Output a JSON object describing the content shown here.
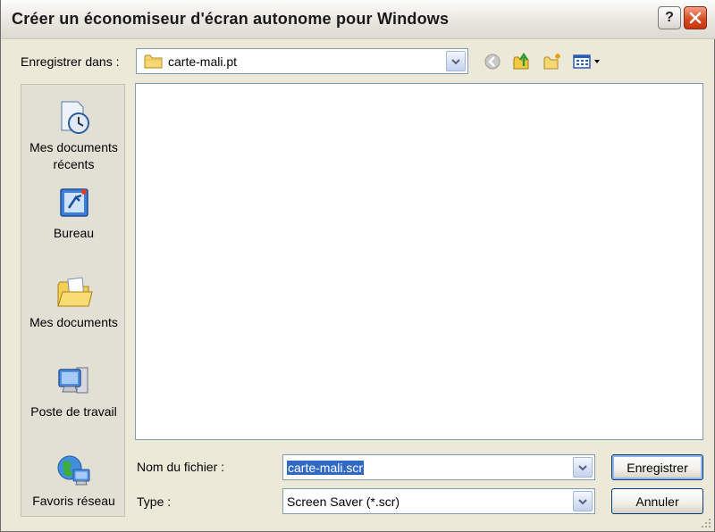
{
  "window": {
    "title": "Créer un économiseur d'écran autonome pour Windows",
    "help_glyph": "?",
    "close_glyph": "✕"
  },
  "toolbar": {
    "save_in_label": "Enregistrer dans :",
    "location": "carte-mali.pt",
    "icons": [
      "back-icon",
      "up-folder-icon",
      "new-folder-icon",
      "view-menu-icon"
    ]
  },
  "places": [
    {
      "label": "Mes documents récents",
      "icon": "recent-documents-icon"
    },
    {
      "label": "Bureau",
      "icon": "desktop-icon"
    },
    {
      "label": "Mes documents",
      "icon": "my-documents-icon"
    },
    {
      "label": "Poste de travail",
      "icon": "my-computer-icon"
    },
    {
      "label": "Favoris réseau",
      "icon": "network-places-icon"
    }
  ],
  "form": {
    "filename_label": "Nom du fichier :",
    "filename_value": "carte-mali.scr",
    "type_label": "Type :",
    "type_value": "Screen Saver (*.scr)",
    "save_label": "Enregistrer",
    "cancel_label": "Annuler"
  },
  "colors": {
    "selection": "#316ac5",
    "close_button": "#d74d25",
    "field_border": "#7f9db9"
  }
}
